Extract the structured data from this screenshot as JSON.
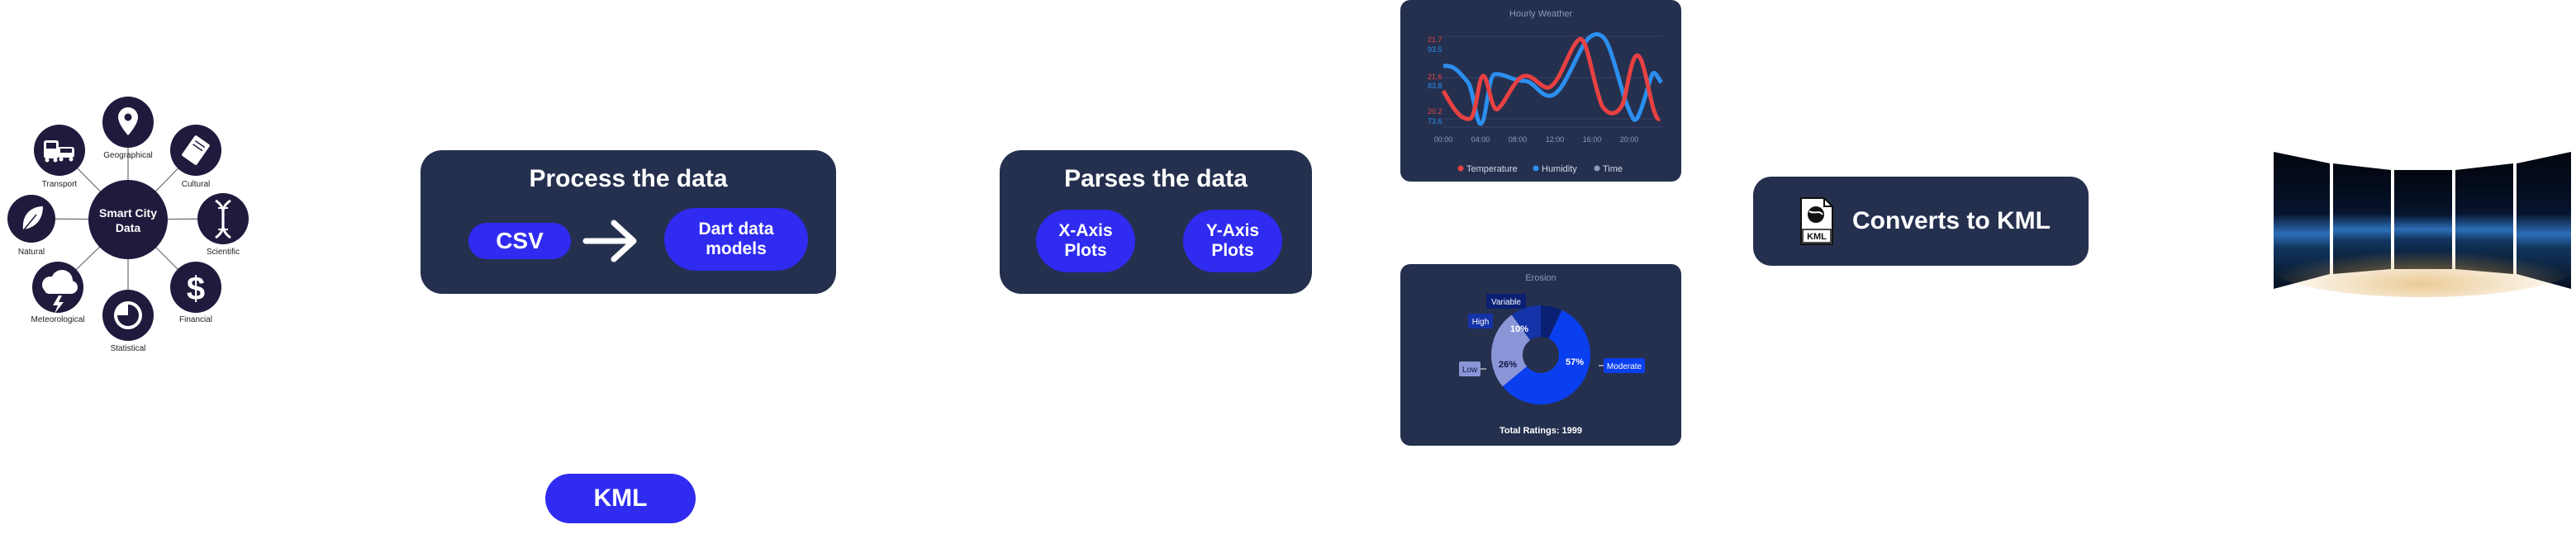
{
  "smart_city": {
    "center_label": "Smart City Data",
    "categories": [
      {
        "label": "Geographical",
        "icon": "map-pin-icon"
      },
      {
        "label": "Cultural",
        "icon": "book-icon"
      },
      {
        "label": "Scientific",
        "icon": "dna-icon"
      },
      {
        "label": "Financial",
        "icon": "dollar-icon"
      },
      {
        "label": "Statistical",
        "icon": "pie-chart-icon"
      },
      {
        "label": "Meteorological",
        "icon": "storm-cloud-icon"
      },
      {
        "label": "Natural",
        "icon": "leaf-icon"
      },
      {
        "label": "Transport",
        "icon": "bus-car-icon"
      }
    ]
  },
  "process_card": {
    "title": "Process the data",
    "csv_label": "CSV",
    "models_label": "Dart data models"
  },
  "parse_card": {
    "title": "Parses the data",
    "x_label": "X-Axis Plots",
    "y_label": "Y-Axis Plots"
  },
  "kml_pill": {
    "label": "KML"
  },
  "kml_card": {
    "title": "Converts to KML",
    "icon_text": "KML"
  },
  "chart_data": [
    {
      "type": "line",
      "title": "Hourly Weather",
      "x_ticks": [
        "00:00",
        "04:00",
        "08:00",
        "12:00",
        "16:00",
        "20:00"
      ],
      "y_ticks_left": [
        "21.7",
        "21.6",
        "20.2"
      ],
      "y_ticks_right": [
        "93.5",
        "83.8",
        "73.6"
      ],
      "series": [
        {
          "name": "Temperature",
          "color": "#e84142"
        },
        {
          "name": "Humidity",
          "color": "#2b8ff0"
        },
        {
          "name": "Time",
          "color": "#8a9bb5"
        }
      ],
      "legend": "bottom"
    },
    {
      "type": "pie",
      "title": "Erosion",
      "slices": [
        {
          "label": "Moderate",
          "value": 57,
          "text": "57%",
          "color": "#0a3ff0"
        },
        {
          "label": "Low",
          "value": 26,
          "text": "26%",
          "color": "#8b96d8"
        },
        {
          "label": "High",
          "value": 10,
          "text": "10%",
          "color": "#1533a8"
        },
        {
          "label": "Variable",
          "value": 7,
          "text": "",
          "color": "#0b1f73"
        }
      ],
      "footer": "Total Ratings: 1999"
    }
  ]
}
